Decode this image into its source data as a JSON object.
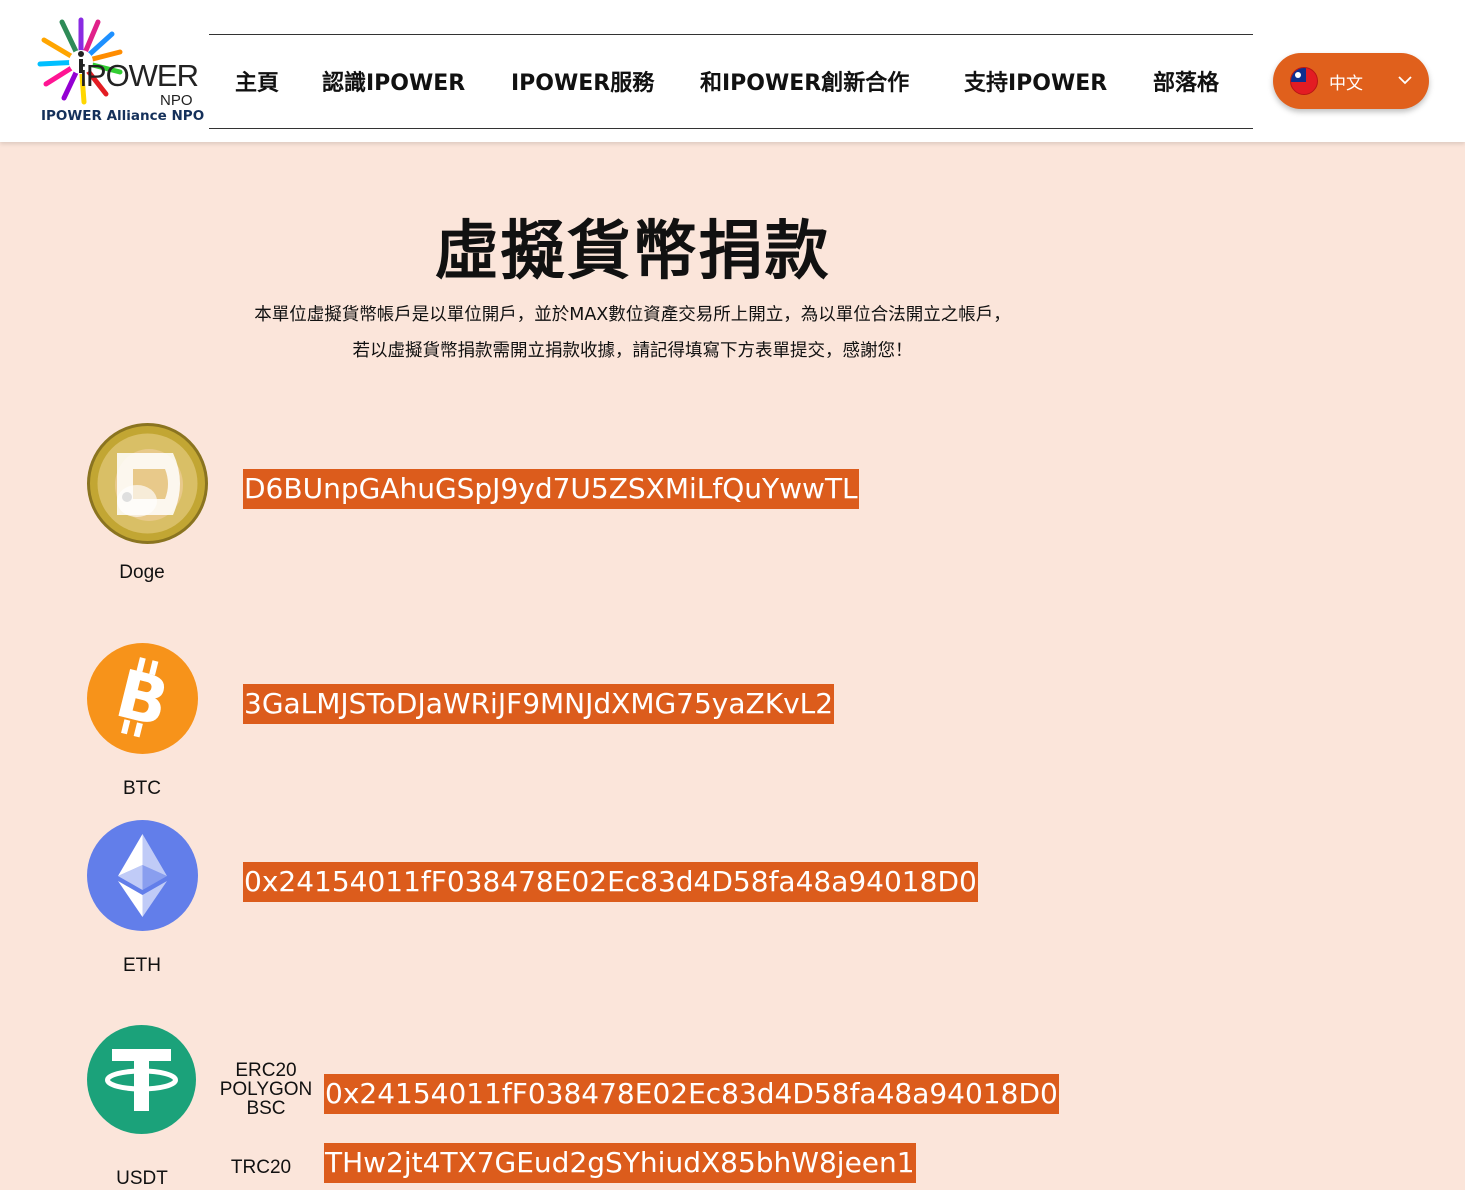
{
  "header": {
    "logo_wordmark": "iPOWER",
    "logo_npo": "NPO",
    "logo_subtitle": "IPOWER Alliance NPO",
    "nav": [
      {
        "label": "主頁"
      },
      {
        "label": "認識IPOWER"
      },
      {
        "label": "IPOWER服務"
      },
      {
        "label": "和IPOWER創新合作"
      },
      {
        "label": "支持IPOWER"
      },
      {
        "label": "部落格"
      }
    ],
    "language": {
      "label": "中文",
      "flag": "taiwan-flag-icon",
      "accent": "#e0601c"
    }
  },
  "main": {
    "title": "虛擬貨幣捐款",
    "intro_line1": "本單位虛擬貨幣帳戶是以單位開戶，並於MAX數位資產交易所上開立，為以單位合法開立之帳戶，",
    "intro_line2": "若以虛擬貨幣捐款需開立捐款收據，請記得填寫下方表單提交，感謝您！",
    "background": "#fbe5da",
    "address_highlight": "#dc5c1c",
    "wallets": [
      {
        "coin": "Doge",
        "icon": "dogecoin-icon",
        "address": "D6BUnpGAhuGSpJ9yd7U5ZSXMiLfQuYwwTL"
      },
      {
        "coin": "BTC",
        "icon": "bitcoin-icon",
        "address": "3GaLMJSToDJaWRiJF9MNJdXMG75yaZKvL2"
      },
      {
        "coin": "ETH",
        "icon": "ethereum-icon",
        "address": "0x24154011fF038478E02Ec83d4D58fa48a94018D0"
      },
      {
        "coin": "USDT",
        "icon": "tether-icon",
        "networks": [
          {
            "label_lines": [
              "ERC20",
              "POLYGON",
              "BSC"
            ],
            "address": "0x24154011fF038478E02Ec83d4D58fa48a94018D0"
          },
          {
            "label_lines": [
              "TRC20"
            ],
            "address": "THw2jt4TX7GEud2gSYhiudX85bhW8jeen1"
          }
        ]
      }
    ]
  }
}
